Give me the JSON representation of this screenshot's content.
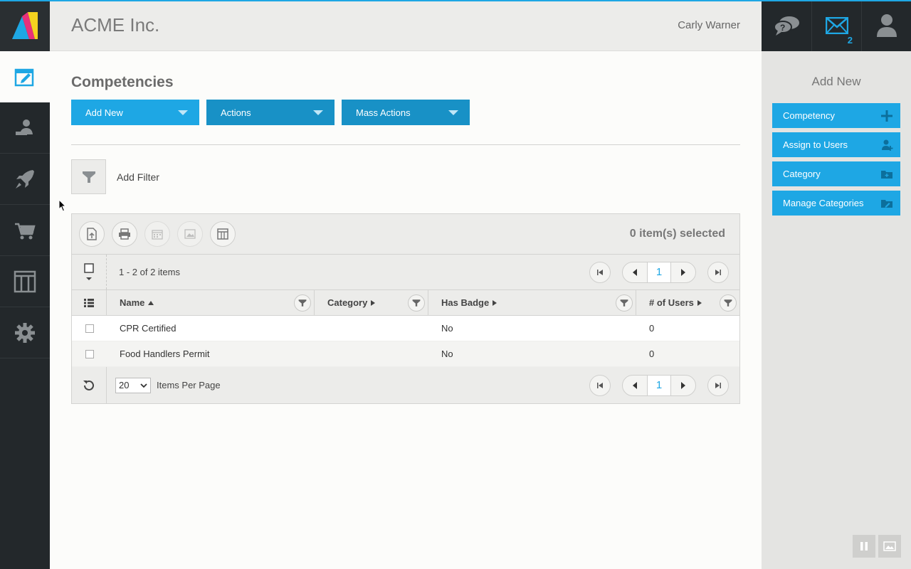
{
  "header": {
    "company": "ACME Inc.",
    "user_name": "Carly Warner",
    "messages_count": "2"
  },
  "nav": {
    "items": [
      {
        "icon": "edit-icon",
        "active": true
      },
      {
        "icon": "users-icon",
        "active": false
      },
      {
        "icon": "rocket-icon",
        "active": false
      },
      {
        "icon": "cart-icon",
        "active": false
      },
      {
        "icon": "columns-icon",
        "active": false
      },
      {
        "icon": "gear-icon",
        "active": false
      }
    ]
  },
  "page": {
    "title": "Competencies",
    "buttons": {
      "add_new": "Add New",
      "actions": "Actions",
      "mass_actions": "Mass Actions"
    },
    "add_filter": "Add Filter"
  },
  "grid": {
    "selected_count": "0 item(s) selected",
    "items_info": "1 - 2 of 2 items",
    "current_page": "1",
    "columns": {
      "name": "Name",
      "category": "Category",
      "has_badge": "Has Badge",
      "num_users": "# of Users"
    },
    "rows": [
      {
        "name": "CPR Certified",
        "category": "",
        "has_badge": "No",
        "num_users": "0"
      },
      {
        "name": "Food Handlers Permit",
        "category": "",
        "has_badge": "No",
        "num_users": "0"
      }
    ],
    "page_size": "20",
    "items_per_page_label": "Items Per Page"
  },
  "right_panel": {
    "title": "Add New",
    "buttons": [
      "Competency",
      "Assign to Users",
      "Category",
      "Manage Categories"
    ]
  },
  "colors": {
    "accent": "#1ea7e4",
    "nav_bg": "#23282b"
  }
}
